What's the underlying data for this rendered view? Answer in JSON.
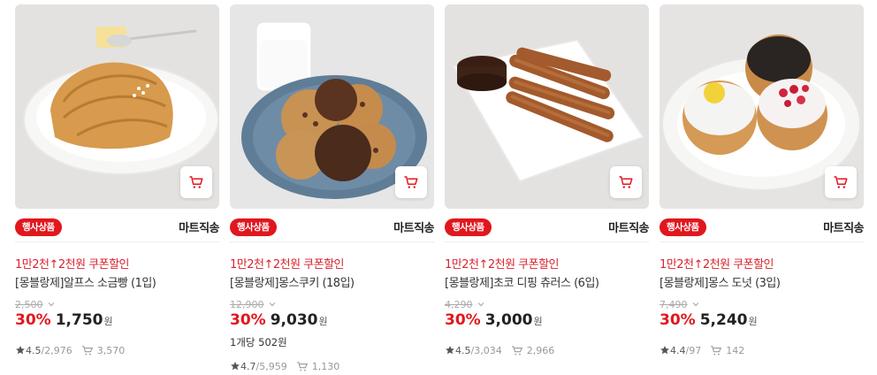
{
  "colors": {
    "accent": "#e1171e",
    "coupon": "#d9232d"
  },
  "products": [
    {
      "badge": "행사상품",
      "delivery": "마트직송",
      "coupon": "1만2천↑2천원 쿠폰할인",
      "name": "[몽블랑제]알프스 소금빵 (1입)",
      "original_price": "2,500",
      "discount_rate": "30%",
      "price": "1,750",
      "currency": "원",
      "unit_price": "",
      "rating": "4.5",
      "reviews": "/2,976",
      "cart_count": "3,570",
      "icon": "salt-bread-photo"
    },
    {
      "badge": "행사상품",
      "delivery": "마트직송",
      "coupon": "1만2천↑2천원 쿠폰할인",
      "name": "[몽블랑제]몽스쿠키 (18입)",
      "original_price": "12,900",
      "discount_rate": "30%",
      "price": "9,030",
      "currency": "원",
      "unit_price": "1개당 502원",
      "rating": "4.7",
      "reviews": "/5,959",
      "cart_count": "1,130",
      "icon": "cookies-photo"
    },
    {
      "badge": "행사상품",
      "delivery": "마트직송",
      "coupon": "1만2천↑2천원 쿠폰할인",
      "name": "[몽블랑제]초코 디핑 츄러스 (6입)",
      "original_price": "4,290",
      "discount_rate": "30%",
      "price": "3,000",
      "currency": "원",
      "unit_price": "",
      "rating": "4.5",
      "reviews": "/3,034",
      "cart_count": "2,966",
      "icon": "churros-photo"
    },
    {
      "badge": "행사상품",
      "delivery": "마트직송",
      "coupon": "1만2천↑2천원 쿠폰할인",
      "name": "[몽블랑제]몽스 도넛 (3입)",
      "original_price": "7,490",
      "discount_rate": "30%",
      "price": "5,240",
      "currency": "원",
      "unit_price": "",
      "rating": "4.4",
      "reviews": "/97",
      "cart_count": "142",
      "icon": "donuts-photo"
    }
  ]
}
